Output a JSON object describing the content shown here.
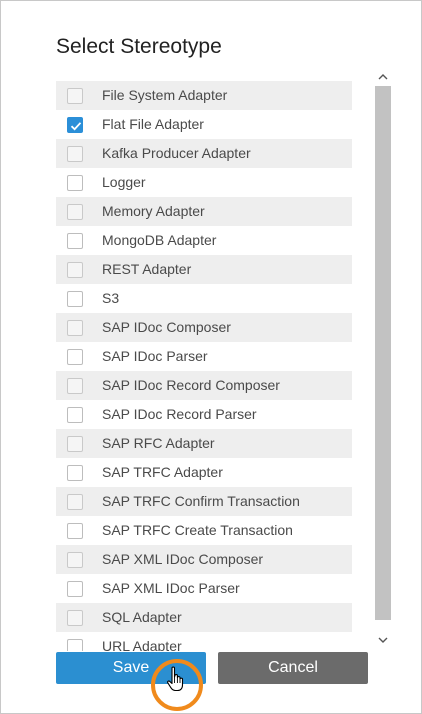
{
  "dialog": {
    "title": "Select Stereotype"
  },
  "items": [
    {
      "label": "File System Adapter",
      "checked": false
    },
    {
      "label": "Flat File Adapter",
      "checked": true
    },
    {
      "label": "Kafka Producer Adapter",
      "checked": false
    },
    {
      "label": "Logger",
      "checked": false
    },
    {
      "label": "Memory Adapter",
      "checked": false
    },
    {
      "label": "MongoDB Adapter",
      "checked": false
    },
    {
      "label": "REST Adapter",
      "checked": false
    },
    {
      "label": "S3",
      "checked": false
    },
    {
      "label": "SAP IDoc Composer",
      "checked": false
    },
    {
      "label": "SAP IDoc Parser",
      "checked": false
    },
    {
      "label": "SAP IDoc Record Composer",
      "checked": false
    },
    {
      "label": "SAP IDoc Record Parser",
      "checked": false
    },
    {
      "label": "SAP RFC Adapter",
      "checked": false
    },
    {
      "label": "SAP TRFC Adapter",
      "checked": false
    },
    {
      "label": "SAP TRFC Confirm Transaction",
      "checked": false
    },
    {
      "label": "SAP TRFC Create Transaction",
      "checked": false
    },
    {
      "label": "SAP XML IDoc Composer",
      "checked": false
    },
    {
      "label": "SAP XML IDoc Parser",
      "checked": false
    },
    {
      "label": "SQL Adapter",
      "checked": false
    },
    {
      "label": "URL Adapter",
      "checked": false
    }
  ],
  "buttons": {
    "save_label": "Save",
    "cancel_label": "Cancel"
  },
  "colors": {
    "accent": "#2b8fd1",
    "cancel": "#6b6b6b",
    "cursor_highlight": "#f08a1c"
  },
  "icons": {
    "checkmark": "check-icon",
    "scroll_up": "chevron-up-icon",
    "scroll_down": "chevron-down-icon",
    "cursor": "hand-pointer-icon"
  }
}
